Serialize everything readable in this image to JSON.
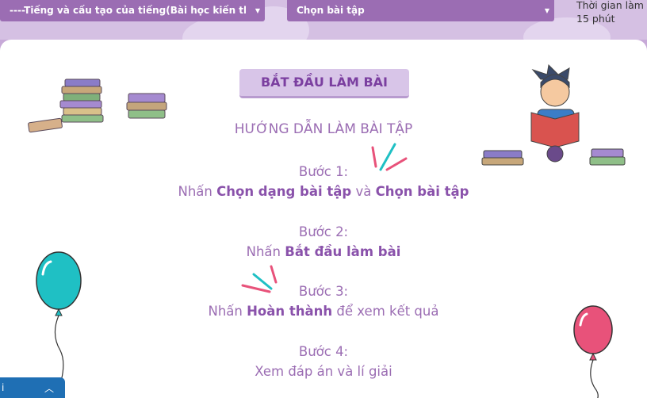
{
  "filters": {
    "type_select": {
      "value": "----Tiếng và cấu tạo của tiếng(Bài học kiến thức cơ"
    },
    "exercise_select": {
      "value": "Chọn bài tập"
    }
  },
  "timer": {
    "line1": "Thời gian làm b",
    "line2": "15 phút"
  },
  "start_button": "BẮT ĐẦU LÀM BÀI",
  "guide_title": "HƯỚNG DẪN LÀM BÀI TẬP",
  "steps": [
    {
      "label": "Bước 1:",
      "t1": "Nhấn ",
      "b1": "Chọn dạng bài tập",
      "t2": " và ",
      "b2": "Chọn bài tập",
      "t3": ""
    },
    {
      "label": "Bước 2:",
      "t1": "Nhấn ",
      "b1": "Bắt đầu làm bài",
      "t2": "",
      "b2": "",
      "t3": ""
    },
    {
      "label": "Bước 3:",
      "t1": "Nhấn ",
      "b1": "Hoàn thành",
      "t2": " để xem kết quả",
      "b2": "",
      "t3": ""
    },
    {
      "label": "Bước 4:",
      "t1": "Xem đáp án và lí giải",
      "b1": "",
      "t2": "",
      "b2": "",
      "t3": ""
    }
  ],
  "bottom_tab": {
    "label": "i"
  },
  "icons": {
    "caret": "caret-down-icon",
    "chevron": "chevron-up-icon",
    "colors": {
      "purple": "#9b6db3",
      "teal": "#1fc0c4",
      "pink": "#e8527a",
      "blue": "#1f6fb4"
    }
  }
}
